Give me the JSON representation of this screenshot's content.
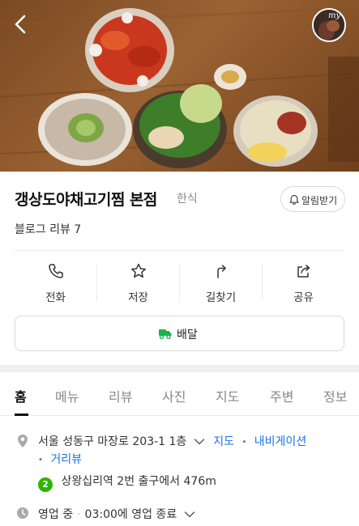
{
  "header": {
    "avatar_text": "my"
  },
  "place": {
    "name": "갱상도야채고기찜 본점",
    "category": "한식",
    "alarm_label": "알림받기",
    "review_text": "블로그 리뷰 7"
  },
  "actions": [
    {
      "label": "전화",
      "icon": "phone-icon"
    },
    {
      "label": "저장",
      "icon": "star-icon"
    },
    {
      "label": "길찾기",
      "icon": "directions-icon"
    },
    {
      "label": "공유",
      "icon": "share-icon"
    }
  ],
  "delivery": {
    "label": "배달",
    "icon": "delivery-icon"
  },
  "tabs": [
    {
      "label": "홈",
      "active": true
    },
    {
      "label": "메뉴"
    },
    {
      "label": "리뷰"
    },
    {
      "label": "사진"
    },
    {
      "label": "지도"
    },
    {
      "label": "주변"
    },
    {
      "label": "정보"
    }
  ],
  "info": {
    "address": "서울 성동구 마장로 203-1 1층",
    "map_link": "지도",
    "navigation_link": "내비게이션",
    "street_view_link": "거리뷰",
    "subway_line": "2",
    "station_text": "상왕십리역 2번 출구에서 476m",
    "status": "영업 중",
    "hours": "03:00에 영업 종료"
  },
  "colors": {
    "link": "#1a73e8",
    "subway_line2": "#2db400",
    "delivery_green": "#19b34c"
  }
}
